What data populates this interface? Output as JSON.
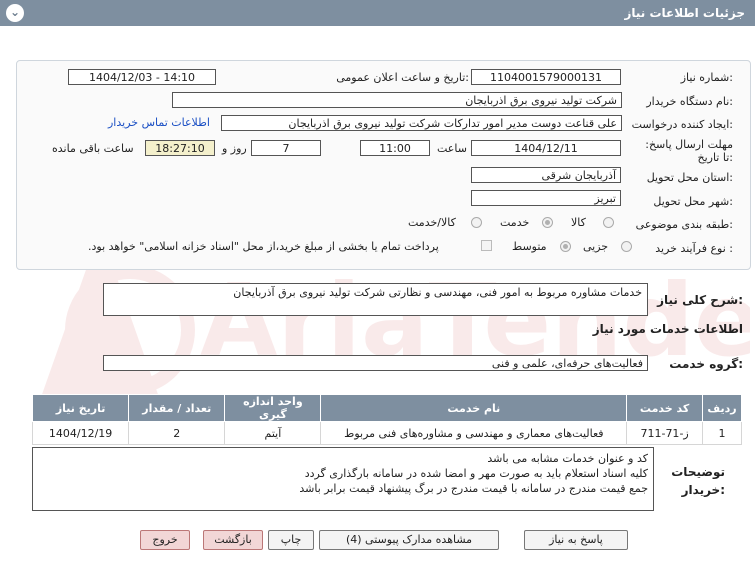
{
  "header": {
    "title": "جزئیات اطلاعات نیاز",
    "chevron": "⌄"
  },
  "fields": {
    "need_number_label": "شماره نیاز:",
    "need_number": "1104001579000131",
    "announce_label": "تاریخ و ساعت اعلان عمومی:",
    "announce_value": "1404/12/03 - 14:10",
    "buyer_org_label": "نام دستگاه خریدار:",
    "buyer_org": "شرکت تولید نیروی برق اذربایجان",
    "creator_label": "ایجاد کننده درخواست:",
    "creator": "علی قناعت دوست مدیر امور تدارکات شرکت تولید نیروی برق اذربایجان",
    "contact_link": "اطلاعات تماس خریدار",
    "deadline_label": "مهلت ارسال پاسخ: تا تاریخ:",
    "deadline_date": "1404/12/11",
    "time_label": "ساعت",
    "deadline_time": "11:00",
    "days_value": "7",
    "days_label": "روز و",
    "remaining_time": "18:27:10",
    "remaining_label": "ساعت باقی مانده",
    "province_label": "استان محل تحویل:",
    "province": "آذربایجان شرقی",
    "city_label": "شهر محل تحویل:",
    "city": "تبریز",
    "category_label": "طبقه بندی موضوعی:",
    "category_options": [
      "کالا",
      "خدمت",
      "کالا/خدمت"
    ],
    "process_label": "نوع فرآیند خرید :",
    "process_options": [
      "جزیی",
      "متوسط"
    ],
    "payment_note": "پرداخت تمام یا بخشی از مبلغ خرید،از محل \"اسناد خزانه اسلامی\" خواهد بود."
  },
  "summary": {
    "label": "شرح کلی نیاز:",
    "text": "خدمات مشاوره مربوط به امور فنی، مهندسی و نظارتی شرکت تولید نیروی برق آذربایجان"
  },
  "services": {
    "title": "اطلاعات خدمات مورد نیاز",
    "group_label": "گروه خدمت:",
    "group_value": "فعالیت‌های حرفه‌ای، علمی و فنی",
    "columns": [
      "ردیف",
      "کد خدمت",
      "نام خدمت",
      "واحد اندازه گیری",
      "تعداد / مقدار",
      "تاریخ نیاز"
    ],
    "rows": [
      [
        "1",
        "ز-71-711",
        "فعالیت‌های معماری و مهندسی و مشاوره‌های فنی مربوط",
        "آیتم",
        "2",
        "1404/12/19"
      ]
    ]
  },
  "notes": {
    "label": "توضیحات خریدار:",
    "lines": [
      "کد و عنوان خدمات مشابه می باشد",
      "کلیه اسناد استعلام باید به صورت مهر و امضا شده در سامانه بارگذاری گردد",
      "جمع قیمت مندرج در سامانه با قیمت مندرج در برگ پیشنهاد قیمت برابر باشد"
    ]
  },
  "buttons": {
    "reply": "پاسخ به نیاز",
    "attachments": "مشاهده مدارک پیوستی (4)",
    "print": "چاپ",
    "back": "بازگشت",
    "exit": "خروج"
  },
  "watermark": {
    "text": "AriaTender.net"
  },
  "colors": {
    "header": "#7e8fa0",
    "link": "#1a4fc4",
    "time_box": "#f4f0cc",
    "pink_button": "#f2d6d6",
    "watermark": "#c62828"
  }
}
